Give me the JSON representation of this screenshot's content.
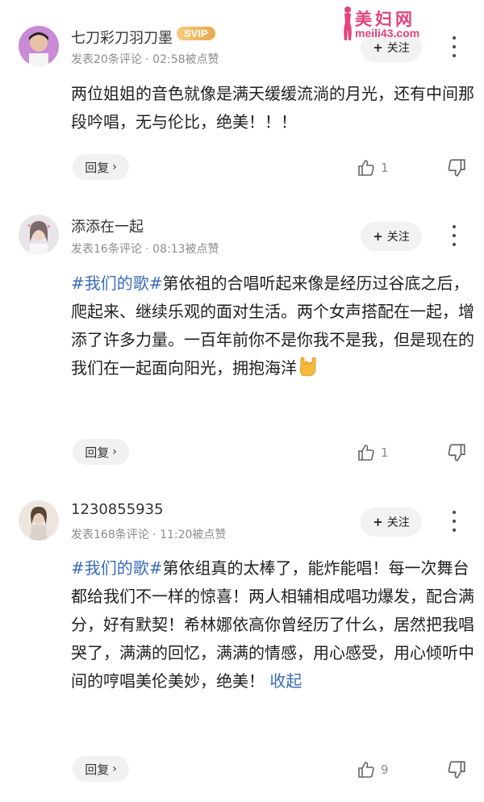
{
  "watermark": {
    "title": "美妇网",
    "url": "meili43.com"
  },
  "follow_label": "关注",
  "reply_label": "回复",
  "comments": [
    {
      "username": "七刀彩刀羽刀墨",
      "badge": "SVIP",
      "meta": "发表20条评论  ·  02:58被点赞",
      "text": "两位姐姐的音色就像是满天缓缓流淌的月光，还有中间那段吟唱，无与伦比，绝美！！！",
      "likes": "1"
    },
    {
      "username": "添添在一起",
      "meta": "发表16条评论  ·  08:13被点赞",
      "hashtag": "#我们的歌#",
      "text": "第依祖的合唱听起来像是经历过谷底之后，爬起来、继续乐观的面对生活。两个女声搭配在一起，增添了许多力量。一百年前你不是你我不是我，但是现在的我们在一起面向阳光，拥抱海洋",
      "emoji": "rock-on-hand",
      "likes": "1"
    },
    {
      "username": "1230855935",
      "meta": "发表168条评论  ·  11:20被点赞",
      "hashtag": "#我们的歌#",
      "text": "第依组真的太棒了，能炸能唱！每一次舞台都给我们不一样的惊喜！两人相辅相成唱功爆发，配合满分，好有默契！希林娜依高你曾经历了什么，居然把我唱哭了，满满的回忆，满满的情感，用心感受，用心倾听中间的哼唱美伦美妙，绝美！",
      "fold_label": "收起",
      "likes": "9"
    }
  ]
}
